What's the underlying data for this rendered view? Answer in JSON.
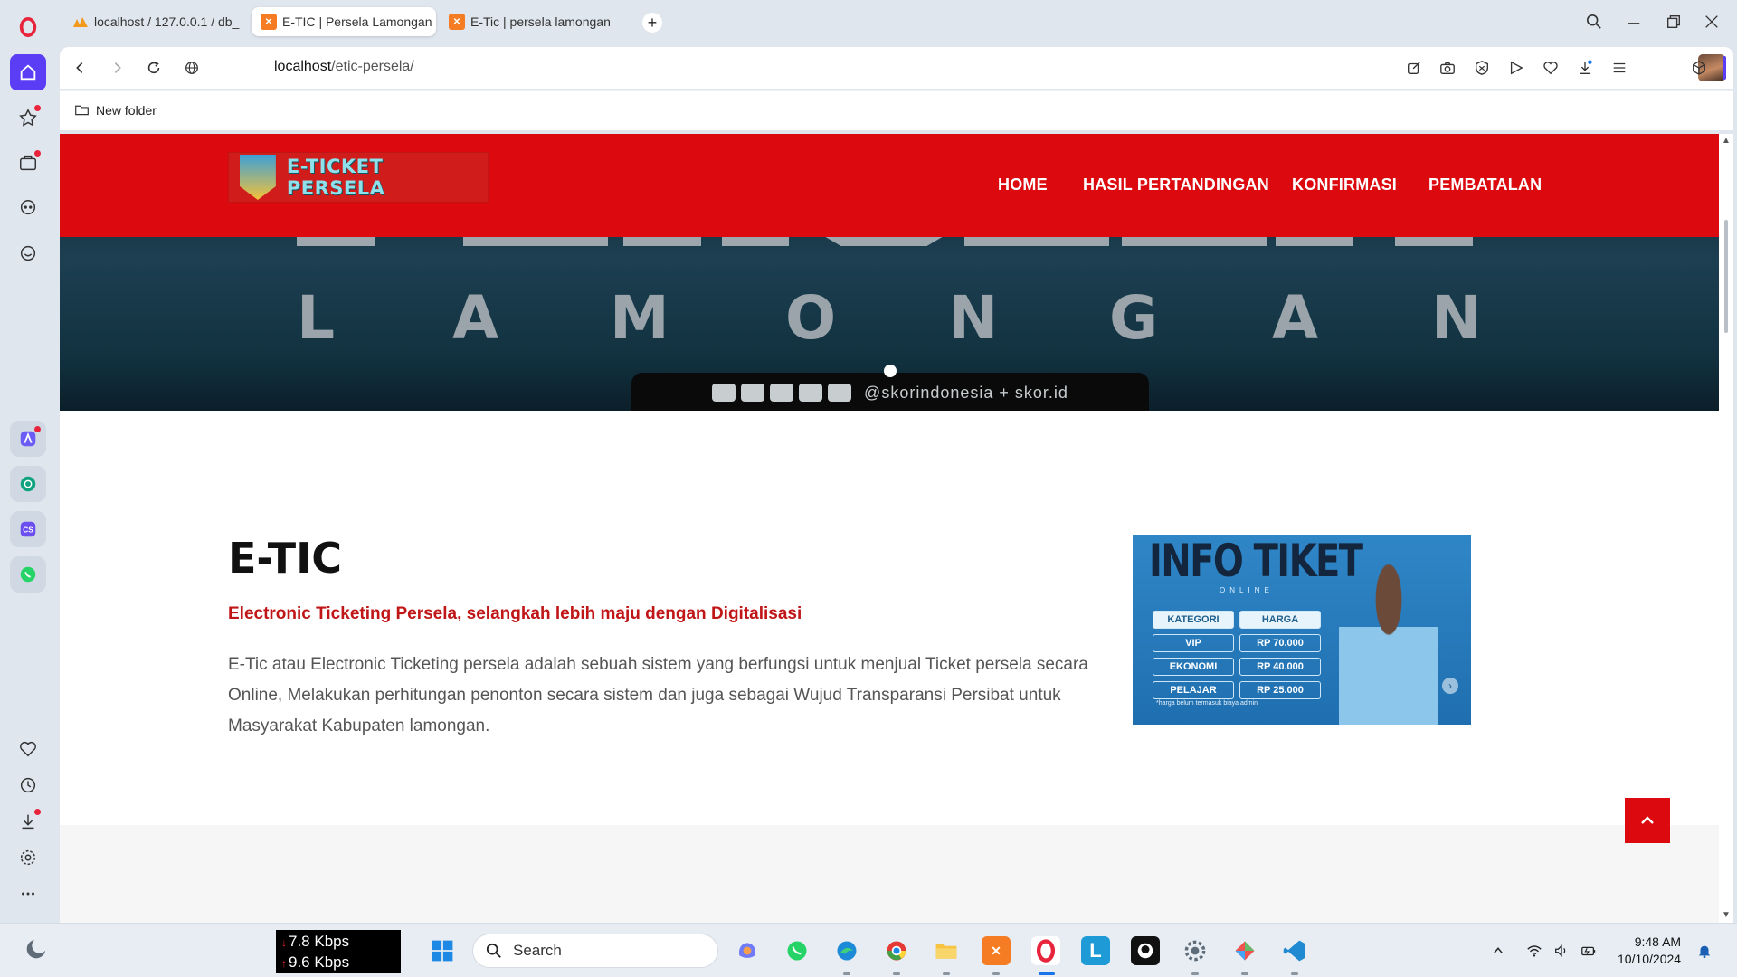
{
  "browser": {
    "tabs": [
      {
        "label": "localhost / 127.0.0.1 / db_",
        "favicon": "phpmyadmin-icon",
        "active": false
      },
      {
        "label": "E-TIC | Persela Lamongan",
        "favicon": "xampp-icon",
        "active": true
      },
      {
        "label": "E-Tic | persela lamongan",
        "favicon": "xampp-icon",
        "active": false
      }
    ],
    "new_tab": "+",
    "url_host": "localhost",
    "url_path": "/etic-persela/",
    "bookmark_folder": "New folder"
  },
  "site": {
    "brand": "E-TICKET PERSELA",
    "menu": [
      "HOME",
      "HASIL PERTANDINGAN",
      "KONFIRMASI",
      "PEMBATALAN"
    ],
    "hero_letters": [
      "L",
      "A",
      "M",
      "O",
      "N",
      "G",
      "A",
      "N"
    ],
    "hero_social_text": "@skorindonesia + skor.id",
    "about_title": "E-TIC",
    "about_subtitle": "Electronic Ticketing Persela, selangkah lebih maju dengan Digitalisasi",
    "about_description": "E-Tic atau Electronic Ticketing persela adalah sebuah sistem yang berfungsi untuk menjual Ticket persela secara Online, Melakukan perhitungan penonton secara sistem dan juga sebagai Wujud Transparansi Persibat untuk Masyarakat Kabupaten lamongan.",
    "info_ticket": {
      "title": "INFO TIKET",
      "subtitle": "ONLINE",
      "headers": [
        "KATEGORI",
        "HARGA"
      ],
      "rows": [
        {
          "category": "VIP",
          "price": "RP 70.000"
        },
        {
          "category": "EKONOMI",
          "price": "RP 40.000"
        },
        {
          "category": "PELAJAR",
          "price": "RP 25.000"
        }
      ],
      "note": "*harga belum termasuk biaya admin"
    }
  },
  "taskbar": {
    "net_down": "7.8 Kbps",
    "net_up": "9.6 Kbps",
    "search_placeholder": "Search",
    "time": "9:48 AM",
    "date": "10/10/2024"
  },
  "colors": {
    "brand_red": "#dc0a0f",
    "opera_accent": "#5b3df5",
    "subtitle_red": "#c01618"
  }
}
